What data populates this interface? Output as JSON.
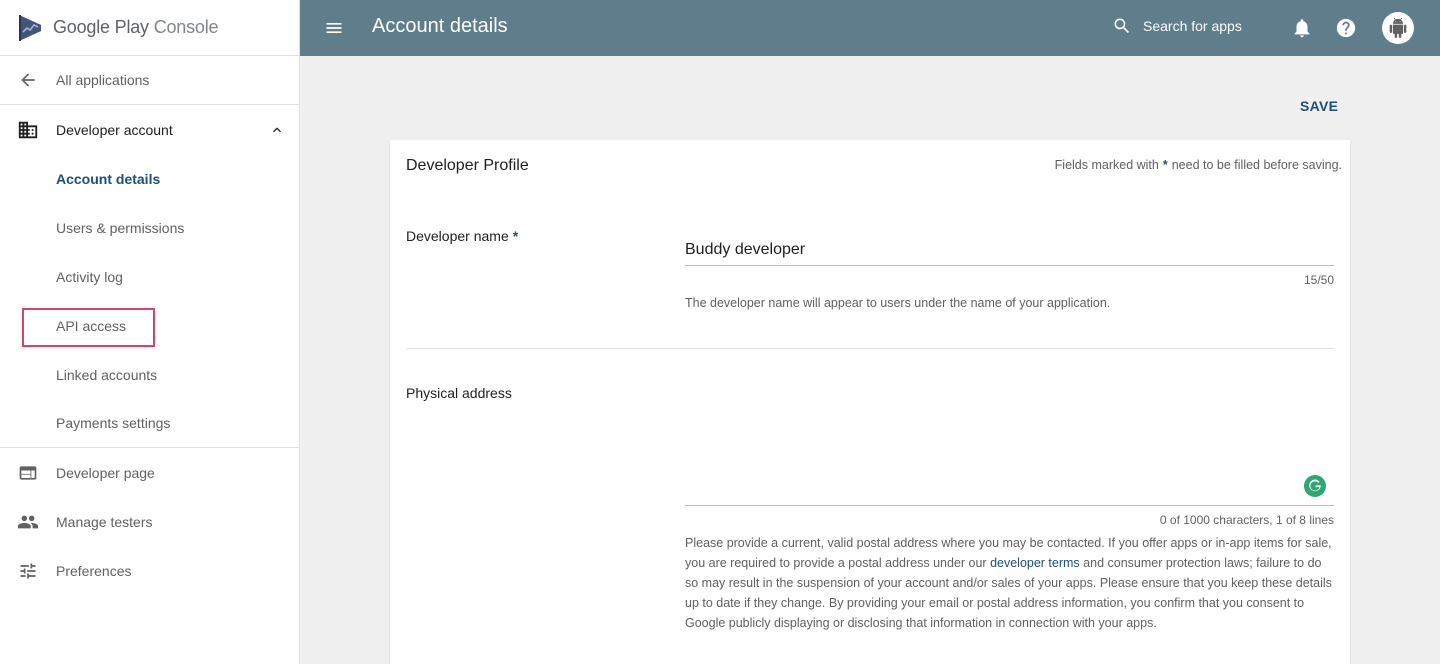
{
  "app": {
    "brand": "Google Play",
    "product": "Console"
  },
  "sidebar": {
    "back_label": "All applications",
    "section": {
      "label": "Developer account",
      "expanded": true,
      "items": [
        {
          "label": "Account details",
          "active": true
        },
        {
          "label": "Users & permissions",
          "active": false
        },
        {
          "label": "Activity log",
          "active": false
        },
        {
          "label": "API access",
          "active": false,
          "highlighted": true
        },
        {
          "label": "Linked accounts",
          "active": false
        },
        {
          "label": "Payments settings",
          "active": false
        }
      ]
    },
    "bottom_items": [
      {
        "label": "Developer page",
        "icon": "web-page-icon"
      },
      {
        "label": "Manage testers",
        "icon": "people-icon"
      },
      {
        "label": "Preferences",
        "icon": "tune-icon"
      }
    ]
  },
  "topbar": {
    "title": "Account details",
    "search_placeholder": "Search for apps",
    "bg_color": "#607d8b"
  },
  "main": {
    "save_label": "SAVE",
    "card": {
      "title": "Developer Profile",
      "required_note_before": "Fields marked with",
      "required_star": "*",
      "required_note_after": "need to be filled before saving.",
      "developer_name": {
        "label": "Developer name",
        "required": "*",
        "value": "Buddy developer",
        "counter": "15/50",
        "hint": "The developer name will appear to users under the name of your application."
      },
      "physical_address": {
        "label": "Physical address",
        "value": "",
        "counter": "0 of 1000 characters, 1 of 8 lines",
        "help_before": "Please provide a current, valid postal address where you may be contacted. If you offer apps or in-app items for sale, you are required to provide a postal address under our ",
        "help_link": "developer terms",
        "help_after": " and consumer protection laws; failure to do so may result in the suspension of your account and/or sales of your apps. Please ensure that you keep these details up to date if they change. By providing your email or postal address information, you confirm that you consent to Google publicly displaying or disclosing that information in connection with your apps."
      }
    }
  },
  "colors": {
    "accent": "#1e4e79",
    "highlight_box": "#d1466a",
    "grammarly": "#2ea872"
  }
}
